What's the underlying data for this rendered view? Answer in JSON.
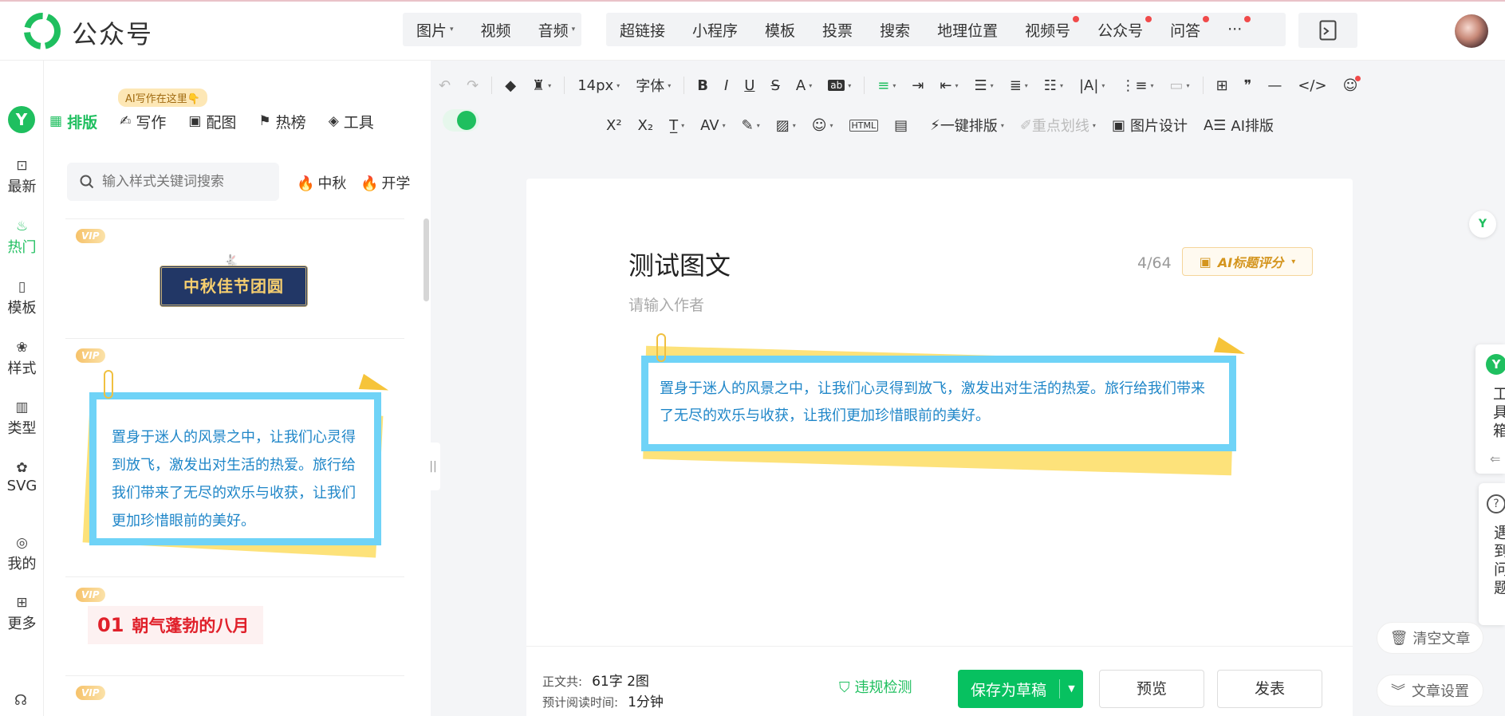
{
  "app": {
    "title": "公众号"
  },
  "topbar": {
    "media": [
      {
        "label": "图片",
        "dropdown": true
      },
      {
        "label": "视频",
        "dropdown": false
      },
      {
        "label": "音频",
        "dropdown": true
      }
    ],
    "insert": [
      {
        "label": "超链接",
        "dot": false
      },
      {
        "label": "小程序",
        "dot": false
      },
      {
        "label": "模板",
        "dot": false
      },
      {
        "label": "投票",
        "dot": false
      },
      {
        "label": "搜索",
        "dot": false
      },
      {
        "label": "地理位置",
        "dot": false
      },
      {
        "label": "视频号",
        "dot": true
      },
      {
        "label": "公众号",
        "dot": true
      },
      {
        "label": "问答",
        "dot": true
      },
      {
        "label": "···",
        "dot": true
      }
    ]
  },
  "leftnav": {
    "brand": "Y",
    "items": [
      {
        "label": "最新",
        "icon": "news-icon",
        "glyph": "⊡",
        "active": false
      },
      {
        "label": "热门",
        "icon": "fire-icon",
        "glyph": "♨",
        "active": true
      },
      {
        "label": "模板",
        "icon": "template-icon",
        "glyph": "▯",
        "active": false
      },
      {
        "label": "样式",
        "icon": "style-icon",
        "glyph": "❀",
        "active": false
      },
      {
        "label": "类型",
        "icon": "type-icon",
        "glyph": "▥",
        "active": false
      },
      {
        "label": "SVG",
        "icon": "svg-icon",
        "glyph": "✿",
        "active": false
      },
      {
        "label": "我的",
        "icon": "user-icon",
        "glyph": "◎",
        "active": false
      },
      {
        "label": "更多",
        "icon": "grid-icon",
        "glyph": "⊞",
        "active": false
      }
    ]
  },
  "panel": {
    "ai_badge": "AI写作在这里👇",
    "tabs": [
      {
        "label": "排版",
        "icon": "layout-icon",
        "glyph": "▦",
        "active": true
      },
      {
        "label": "写作",
        "icon": "write-icon",
        "glyph": "✍",
        "active": false
      },
      {
        "label": "配图",
        "icon": "image-icon",
        "glyph": "▣",
        "active": false
      },
      {
        "label": "热榜",
        "icon": "bookmark-icon",
        "glyph": "⚑",
        "active": false
      },
      {
        "label": "工具",
        "icon": "cube-icon",
        "glyph": "◈",
        "active": false
      }
    ],
    "search_placeholder": "输入样式关键词搜索",
    "hot_tags": [
      "中秋",
      "开学"
    ],
    "vip_label": "VIP",
    "card1_text": "中秋佳节团圆",
    "card2_text": "置身于迷人的风景之中，让我们心灵得到放飞，激发出对生活的热爱。旅行给我们带来了无尽的欢乐与收获，让我们更加珍惜眼前的美好。",
    "card3_num": "01",
    "card3_text": "朝气蓬勃的八月"
  },
  "toolbar": {
    "font_size": "14px",
    "font_family": "字体",
    "row2": {
      "one_click_layout": "一键排版",
      "highlight": "重点划线",
      "image_design": "图片设计",
      "ai_layout": "AI排版"
    }
  },
  "editor": {
    "title": "测试图文",
    "title_count": "4/64",
    "ai_score_label": "AI标题评分",
    "author_placeholder": "请输入作者",
    "body_text": "置身于迷人的风景之中，让我们心灵得到放飞，激发出对生活的热爱。旅行给我们带来了无尽的欢乐与收获，让我们更加珍惜眼前的美好。"
  },
  "bottombar": {
    "word_count_label": "正文共:",
    "word_count_value": "61字 2图",
    "read_time_label": "预计阅读时间:",
    "read_time_value": "1分钟",
    "compliance": "违规检测",
    "save_draft": "保存为草稿",
    "preview": "预览",
    "publish": "发表"
  },
  "right": {
    "toolbox_label": "工具箱",
    "help_label": "遇到问题",
    "clear_article": "清空文章",
    "article_settings": "文章设置"
  },
  "colors": {
    "accent": "#1fbf5f",
    "wechat_green": "#07c160",
    "note_blue": "#6fd3f7",
    "note_text": "#1f86c8",
    "vip_gold": "#f6c26a"
  }
}
